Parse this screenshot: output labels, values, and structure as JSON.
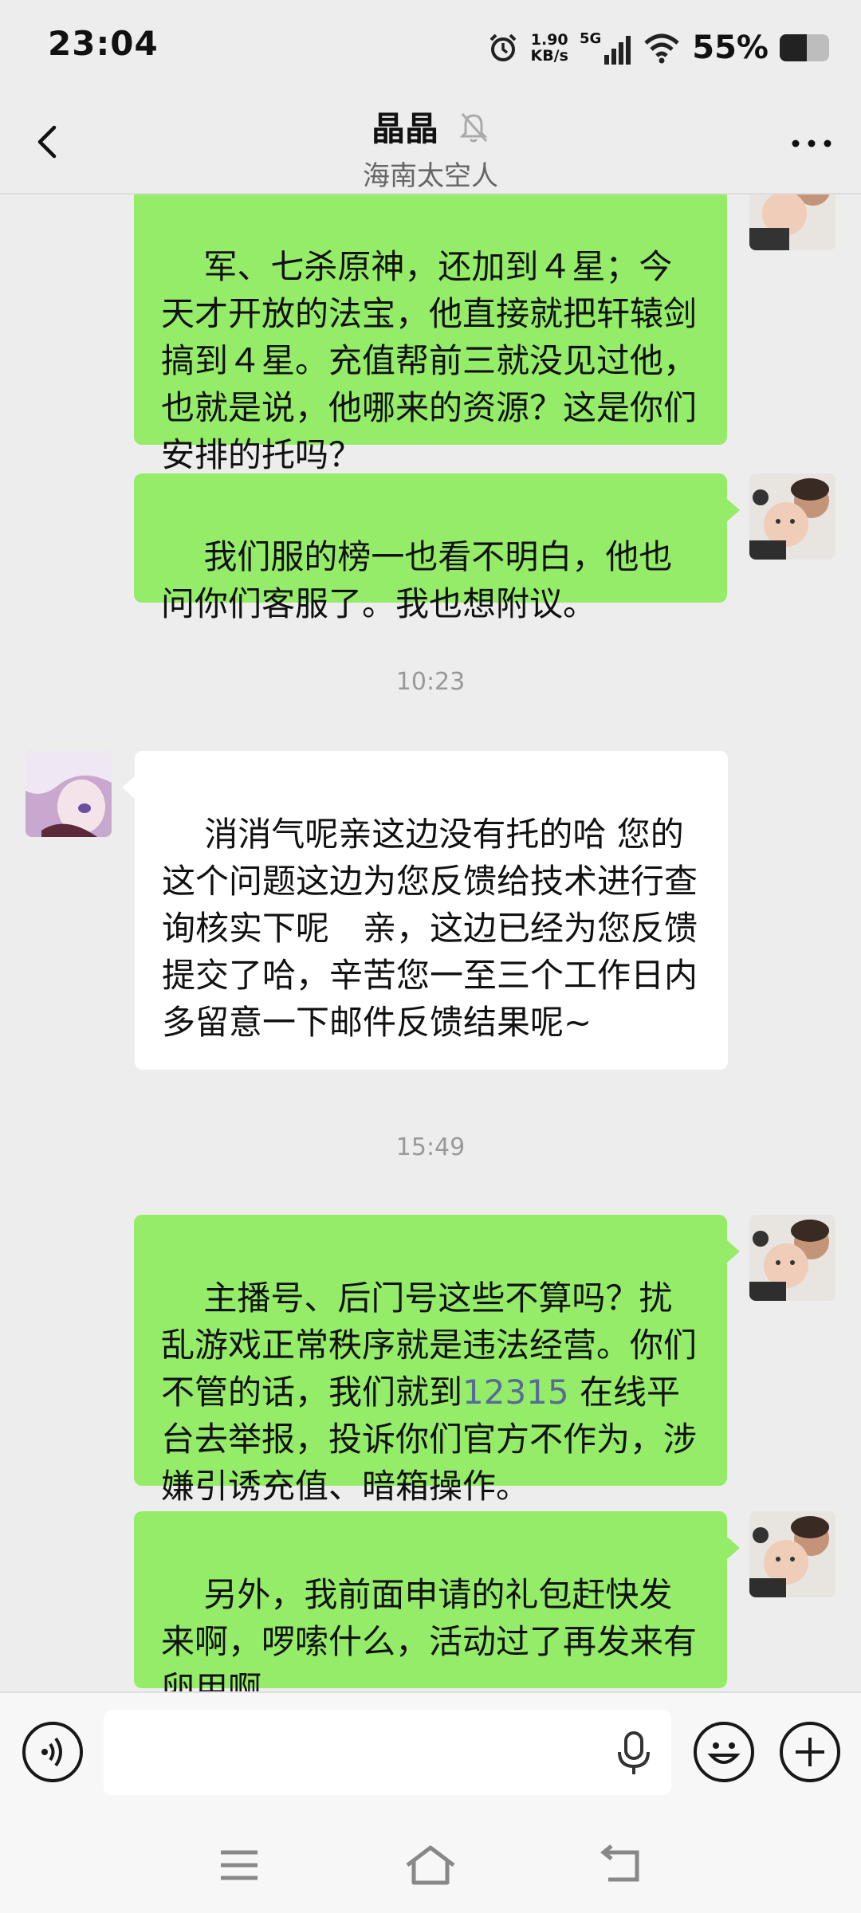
{
  "status_bar": {
    "time": "23:04",
    "net_speed_value": "1.90",
    "net_speed_unit": "KB/s",
    "network": "5G",
    "battery_text": "55%",
    "battery_level": 0.55
  },
  "header": {
    "title": "晶晶",
    "subtitle": "海南太空人",
    "icons": [
      "back-icon",
      "mute-bell-icon",
      "more-icon"
    ]
  },
  "messages": [
    {
      "side": "me",
      "text": "军、七杀原神，还加到４星；今天才开放的法宝，他直接就把轩辕剑搞到４星。充值帮前三就没见过他，也就是说，他哪来的资源？这是你们安排的托吗？"
    },
    {
      "side": "me",
      "text": "我们服的榜一也看不明白，他也问你们客服了。我也想附议。"
    },
    {
      "type": "time",
      "text": "10:23"
    },
    {
      "side": "other",
      "text": "消消气呢亲这边没有托的哈 您的这个问题这边为您反馈给技术进行查询核实下呢　亲，这边已经为您反馈提交了哈，辛苦您一至三个工作日内多留意一下邮件反馈结果呢~"
    },
    {
      "type": "time",
      "text": "15:49"
    },
    {
      "side": "me",
      "text_before": "主播号、后门号这些不算吗？扰乱游戏正常秩序就是违法经营。你们不管的话，我们就到",
      "link": "12315",
      "text_after": "在线平台去举报，投诉你们官方不作为，涉嫌引诱充值、暗箱操作。"
    },
    {
      "side": "me",
      "text": "另外，我前面申请的礼包赶快发来啊，啰嗦什么，活动过了再发来有卵用啊"
    }
  ],
  "input": {
    "value": "",
    "placeholder": ""
  },
  "nav": [
    "menu-icon",
    "home-icon",
    "back-nav-icon"
  ],
  "colors": {
    "my_bubble": "#95ec69",
    "their_bubble": "#ffffff",
    "background": "#ededed",
    "link": "#576b95"
  }
}
